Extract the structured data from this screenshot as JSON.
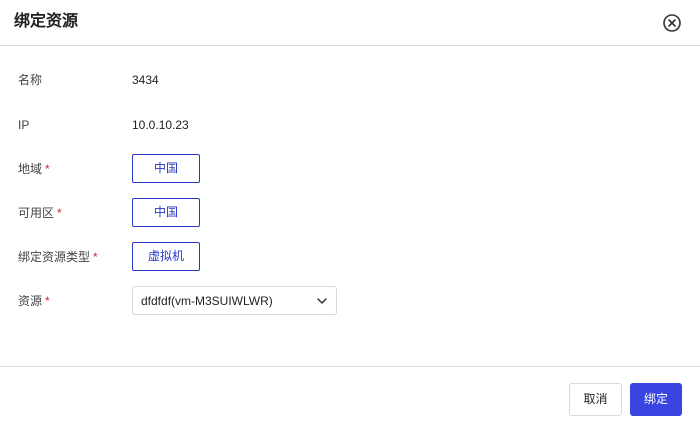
{
  "dialog": {
    "title": "绑定资源",
    "close_icon": "close-circle-icon"
  },
  "form": {
    "name": {
      "label": "名称",
      "value": "3434"
    },
    "ip": {
      "label": "IP",
      "value": "10.0.10.23"
    },
    "region": {
      "label": "地域",
      "required_mark": "*",
      "value": "中国"
    },
    "zone": {
      "label": "可用区",
      "required_mark": "*",
      "value": "中国"
    },
    "resource_type": {
      "label": "绑定资源类型",
      "required_mark": "*",
      "value": "虚拟机"
    },
    "resource": {
      "label": "资源",
      "required_mark": "*",
      "selected": "dfdfdf(vm-M3SUIWLWR)",
      "icon": "chevron-down-icon"
    }
  },
  "footer": {
    "cancel_label": "取消",
    "confirm_label": "绑定"
  },
  "colors": {
    "accent": "#3845e0",
    "outline": "#2838c7",
    "required": "#e02020",
    "divider": "#d9d9d9"
  }
}
